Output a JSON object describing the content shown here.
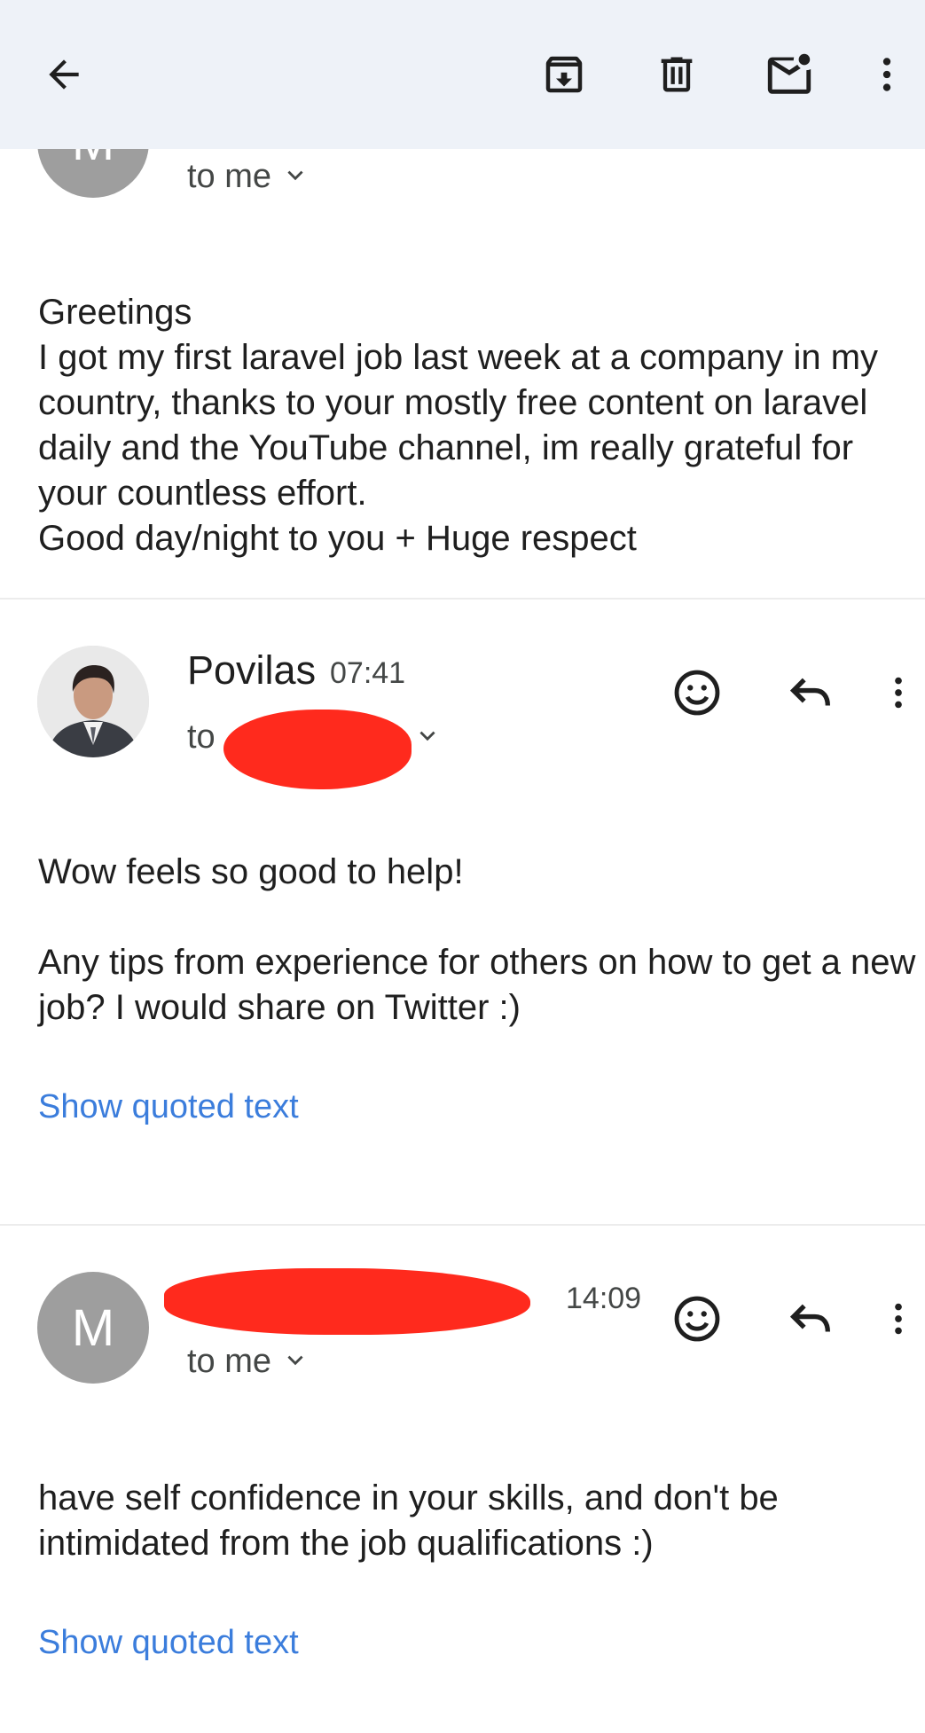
{
  "toolbar": {
    "back_icon": "arrow-back-icon",
    "archive_icon": "archive-icon",
    "delete_icon": "trash-icon",
    "unread_icon": "mark-unread-icon",
    "more_icon": "more-vert-icon",
    "background": "#eef2f8"
  },
  "messages": [
    {
      "avatar_letter": "M",
      "to_label": "to me",
      "body": "Greetings\nI got my first laravel job last week at a company in my country, thanks to your mostly free content on laravel daily and the YouTube channel, im really grateful for your countless effort.\nGood day/night to you + Huge respect"
    },
    {
      "sender": "Povilas",
      "time": "07:41",
      "to_label": "to",
      "body": "Wow feels so good to help!\n\nAny tips from experience for others on how to get a new job? I would share on Twitter :)",
      "show_quoted": "Show quoted text"
    },
    {
      "avatar_letter": "M",
      "time": "14:09",
      "to_label": "to me",
      "body": "have self confidence in your skills, and don't be intimidated from the job qualifications :)",
      "show_quoted": "Show quoted text"
    }
  ],
  "colors": {
    "link": "#3b7ddc",
    "redaction": "#ff2a1d",
    "avatar_bg": "#9e9e9e"
  }
}
